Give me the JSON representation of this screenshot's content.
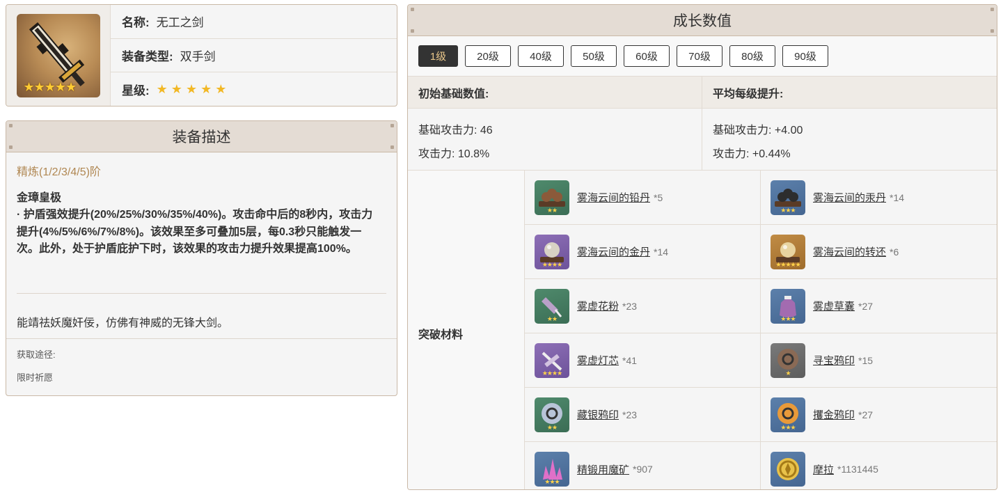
{
  "info": {
    "name_label": "名称:",
    "name_value": "无工之剑",
    "type_label": "装备类型:",
    "type_value": "双手剑",
    "rarity_label": "星级:",
    "rarity_stars": "★★★★★",
    "thumb_stars": "★★★★★"
  },
  "description": {
    "header": "装备描述",
    "refine": "精炼(1/2/3/4/5)阶",
    "skill_name": "金璋皇极",
    "skill_text": "· 护盾强效提升(20%/25%/30%/35%/40%)。攻击命中后的8秒内，攻击力提升(4%/5%/6%/7%/8%)。该效果至多可叠加5层，每0.3秒只能触发一次。此外，处于护盾庇护下时，该效果的攻击力提升效果提高100%。",
    "flavor": "能靖祛妖魔奸佞，仿佛有神威的无锋大剑。",
    "source_label": "获取途径:",
    "source_value": "限时祈愿"
  },
  "growth": {
    "header": "成长数值",
    "levels": [
      {
        "label": "1级",
        "active": true
      },
      {
        "label": "20级",
        "active": false
      },
      {
        "label": "40级",
        "active": false
      },
      {
        "label": "50级",
        "active": false
      },
      {
        "label": "60级",
        "active": false
      },
      {
        "label": "70级",
        "active": false
      },
      {
        "label": "80级",
        "active": false
      },
      {
        "label": "90级",
        "active": false
      }
    ],
    "base_header": "初始基础数值:",
    "avg_header": "平均每级提升:",
    "base_stats": [
      "基础攻击力: 46",
      "攻击力: 10.8%"
    ],
    "avg_stats": [
      "基础攻击力: +4.00",
      "攻击力: +0.44%"
    ],
    "materials_label": "突破材料",
    "materials": [
      {
        "name": "雾海云间的铅丹",
        "count": "*5",
        "rarity": 2,
        "stars": "★★",
        "icon": "bowls-icon",
        "color": "#8b5a3a"
      },
      {
        "name": "雾海云间的汞丹",
        "count": "*14",
        "rarity": 3,
        "stars": "★★★",
        "icon": "bowls-icon",
        "color": "#2d2d2d"
      },
      {
        "name": "雾海云间的金丹",
        "count": "*14",
        "rarity": 4,
        "stars": "★★★★",
        "icon": "pearl-icon",
        "color": "#d8d2c4"
      },
      {
        "name": "雾海云间的转还",
        "count": "*6",
        "rarity": 5,
        "stars": "★★★★★",
        "icon": "pearl-icon",
        "color": "#e8d4a0"
      },
      {
        "name": "雾虚花粉",
        "count": "*23",
        "rarity": 2,
        "stars": "★★",
        "icon": "vial-icon",
        "color": "#b9a0c8"
      },
      {
        "name": "雾虚草囊",
        "count": "*27",
        "rarity": 3,
        "stars": "★★★",
        "icon": "pouch-icon",
        "color": "#a36bb0"
      },
      {
        "name": "雾虚灯芯",
        "count": "*41",
        "rarity": 4,
        "stars": "★★★★",
        "icon": "lantern-icon",
        "color": "#d2c2e0"
      },
      {
        "name": "寻宝鸦印",
        "count": "*15",
        "rarity": 1,
        "stars": "★",
        "icon": "insignia-icon",
        "color": "#8a6a55"
      },
      {
        "name": "藏银鸦印",
        "count": "*23",
        "rarity": 2,
        "stars": "★★",
        "icon": "insignia-icon",
        "color": "#b8c4d8"
      },
      {
        "name": "攫金鸦印",
        "count": "*27",
        "rarity": 3,
        "stars": "★★★",
        "icon": "insignia-icon",
        "color": "#e89a3a"
      },
      {
        "name": "精锻用魔矿",
        "count": "*907",
        "rarity": 3,
        "stars": "★★★",
        "icon": "crystal-icon",
        "color": "#e070c8"
      },
      {
        "name": "摩拉",
        "count": "*1131445",
        "rarity": 3,
        "stars": "",
        "icon": "mora-coin-icon",
        "color": "#e8c24a"
      }
    ]
  }
}
